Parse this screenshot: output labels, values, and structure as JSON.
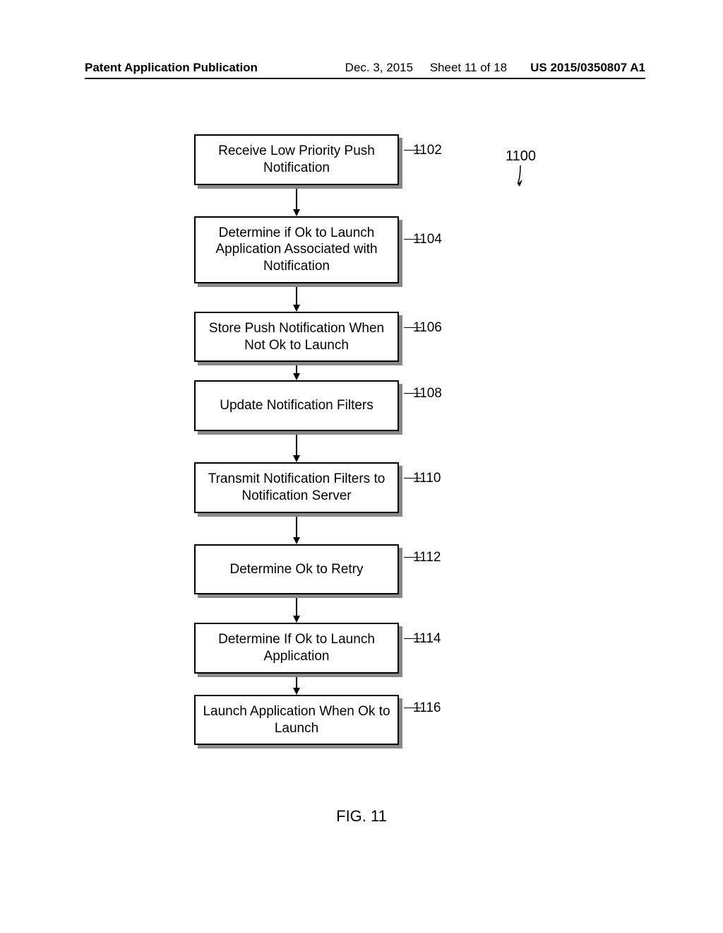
{
  "header": {
    "left": "Patent Application Publication",
    "date": "Dec. 3, 2015",
    "sheet": "Sheet 11 of 18",
    "pubno": "US 2015/0350807 A1"
  },
  "figure_ref": "1100",
  "figure_label": "FIG. 11",
  "steps": [
    {
      "ref": "1102",
      "text": "Receive Low Priority Push Notification"
    },
    {
      "ref": "1104",
      "text": "Determine if Ok to Launch Application Associated with Notification"
    },
    {
      "ref": "1106",
      "text": "Store Push Notification When Not Ok to Launch"
    },
    {
      "ref": "1108",
      "text": "Update Notification Filters"
    },
    {
      "ref": "1110",
      "text": "Transmit Notification Filters to Notification Server"
    },
    {
      "ref": "1112",
      "text": "Determine Ok to Retry"
    },
    {
      "ref": "1114",
      "text": "Determine If Ok to Launch Application"
    },
    {
      "ref": "1116",
      "text": "Launch Application When Ok to Launch"
    }
  ]
}
